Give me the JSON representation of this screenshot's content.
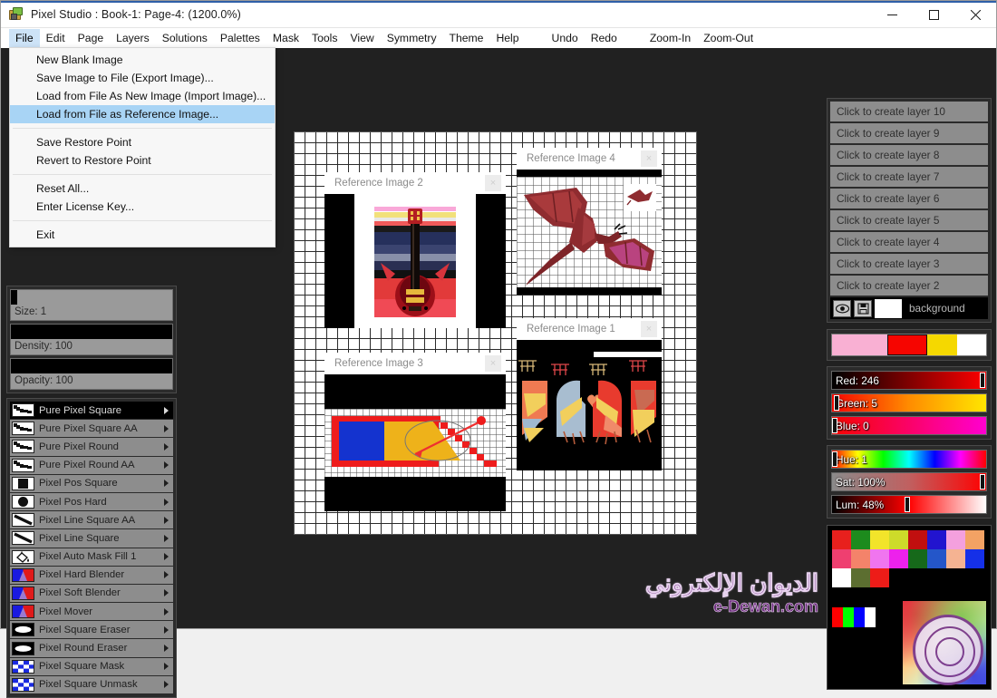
{
  "window": {
    "title": "Pixel Studio : Book-1: Page-4:  (1200.0%)",
    "minimize": "─",
    "maximize": "□",
    "close": "✕"
  },
  "menubar": {
    "items": [
      {
        "label": "File",
        "active": true
      },
      {
        "label": "Edit",
        "active": false
      },
      {
        "label": "Page",
        "active": false
      },
      {
        "label": "Layers",
        "active": false
      },
      {
        "label": "Solutions",
        "active": false
      },
      {
        "label": "Palettes",
        "active": false
      },
      {
        "label": "Mask",
        "active": false
      },
      {
        "label": "Tools",
        "active": false
      },
      {
        "label": "View",
        "active": false
      },
      {
        "label": "Symmetry",
        "active": false
      },
      {
        "label": "Theme",
        "active": false
      },
      {
        "label": "Help",
        "active": false
      }
    ],
    "commands": [
      "Undo",
      "Redo"
    ],
    "zoom_commands": [
      "Zoom-In",
      "Zoom-Out"
    ]
  },
  "file_menu": {
    "items": [
      {
        "label": "New Blank Image",
        "selected": false
      },
      {
        "label": "Save Image to File (Export Image)...",
        "selected": false
      },
      {
        "label": "Load from File As New Image (Import Image)...",
        "selected": false
      },
      {
        "label": "Load from File as Reference Image...",
        "selected": true
      },
      {
        "label": "Save Restore Point",
        "selected": false
      },
      {
        "label": "Revert to Restore Point",
        "selected": false
      },
      {
        "label": "Reset All...",
        "selected": false
      },
      {
        "label": "Enter License Key...",
        "selected": false
      },
      {
        "label": "Exit",
        "selected": false
      }
    ]
  },
  "left_panel": {
    "sliders": [
      {
        "name": "size",
        "label": "Size: 1",
        "fill_percent": 4
      },
      {
        "name": "density",
        "label": "Density: 100",
        "fill_percent": 100
      },
      {
        "name": "opacity",
        "label": "Opacity: 100",
        "fill_percent": 100
      }
    ],
    "tools": [
      {
        "label": "Pure Pixel Square",
        "icon": "brush-stroke-icon",
        "selected": true
      },
      {
        "label": "Pure Pixel Square AA",
        "icon": "brush-stroke-icon",
        "selected": false
      },
      {
        "label": "Pure Pixel Round",
        "icon": "brush-stroke-icon",
        "selected": false
      },
      {
        "label": "Pure Pixel Round AA",
        "icon": "brush-stroke-icon",
        "selected": false
      },
      {
        "label": "Pixel Pos Square",
        "icon": "filled-square-icon",
        "selected": false
      },
      {
        "label": "Pixel Pos Hard",
        "icon": "filled-circle-icon",
        "selected": false
      },
      {
        "label": "Pixel Line Square AA",
        "icon": "diagonal-line-icon",
        "selected": false
      },
      {
        "label": "Pixel Line Square",
        "icon": "diagonal-line-icon",
        "selected": false
      },
      {
        "label": "Pixel Auto Mask Fill 1",
        "icon": "paint-bucket-icon",
        "selected": false
      },
      {
        "label": "Pixel Hard Blender",
        "icon": "blender-icon",
        "selected": false
      },
      {
        "label": "Pixel Soft Blender",
        "icon": "blender-icon",
        "selected": false
      },
      {
        "label": "Pixel Mover",
        "icon": "blender-icon",
        "selected": false
      },
      {
        "label": "Pixel Square Eraser",
        "icon": "eraser-icon",
        "selected": false
      },
      {
        "label": "Pixel Round Eraser",
        "icon": "eraser-round-icon",
        "selected": false
      },
      {
        "label": "Pixel Square Mask",
        "icon": "checker-mask-icon",
        "selected": false
      },
      {
        "label": "Pixel Square Unmask",
        "icon": "checker-mask-icon",
        "selected": false
      }
    ]
  },
  "layers": {
    "placeholders": [
      "Click to create layer 10",
      "Click to create layer 9",
      "Click to create layer 8",
      "Click to create layer 7",
      "Click to create layer 6",
      "Click to create layer 5",
      "Click to create layer 4",
      "Click to create layer 3",
      "Click to create layer 2"
    ],
    "background": {
      "label": "background",
      "visibility_icon": "eye-icon",
      "lock_icon": "save-icon",
      "swatch_color": "#ffffff"
    }
  },
  "color_panel": {
    "swatches": [
      {
        "name": "previous-color",
        "color": "#f9b0d3"
      },
      {
        "name": "current-color",
        "color": "#f60500"
      },
      {
        "name": "secondary-color",
        "color": "#f5d800"
      },
      {
        "name": "white-color",
        "color": "#ffffff"
      }
    ],
    "rgb": [
      {
        "name": "Red",
        "label": "Red: 246",
        "value": 246,
        "thumb_percent": 96
      },
      {
        "name": "Green",
        "label": "Green: 5",
        "value": 5,
        "thumb_percent": 2
      },
      {
        "name": "Blue",
        "label": "Blue: 0",
        "value": 0,
        "thumb_percent": 0
      }
    ],
    "hsl": [
      {
        "name": "Hue",
        "label": "Hue: 1",
        "value": 1,
        "thumb_percent": 1
      },
      {
        "name": "Sat",
        "label": "Sat: 100%",
        "value": 100,
        "thumb_percent": 97
      },
      {
        "name": "Lum",
        "label": "Lum: 48%",
        "value": 48,
        "thumb_percent": 47
      }
    ],
    "palette": [
      "#e8201d",
      "#1d8b1d",
      "#f2e42a",
      "#cddb2a",
      "#c10f0f",
      "#2214cf",
      "#f4a0de",
      "#f3a264",
      "#ef3f70",
      "#f4836a",
      "#f075ef",
      "#ed21ec",
      "#16691a",
      "#2456c9",
      "#f5b392",
      "#1530e8",
      "#ffffff",
      "#5c6e30",
      "#ed1c18"
    ],
    "rgbw_strip": [
      "#ff0000",
      "#00ff00",
      "#0000ff",
      "#ffffff"
    ]
  },
  "canvas": {
    "reference_windows": [
      {
        "title": "Reference Image 2",
        "close": "×",
        "kind": "guitar"
      },
      {
        "title": "Reference Image 4",
        "close": "×",
        "kind": "dragon"
      },
      {
        "title": "Reference Image 3",
        "close": "×",
        "kind": "pixel-shape"
      },
      {
        "title": "Reference Image 1",
        "close": "×",
        "kind": "pixel-birds"
      }
    ]
  },
  "watermark": {
    "arabic": "الديوان الإلكتروني",
    "english": "e-Dewan.com"
  }
}
